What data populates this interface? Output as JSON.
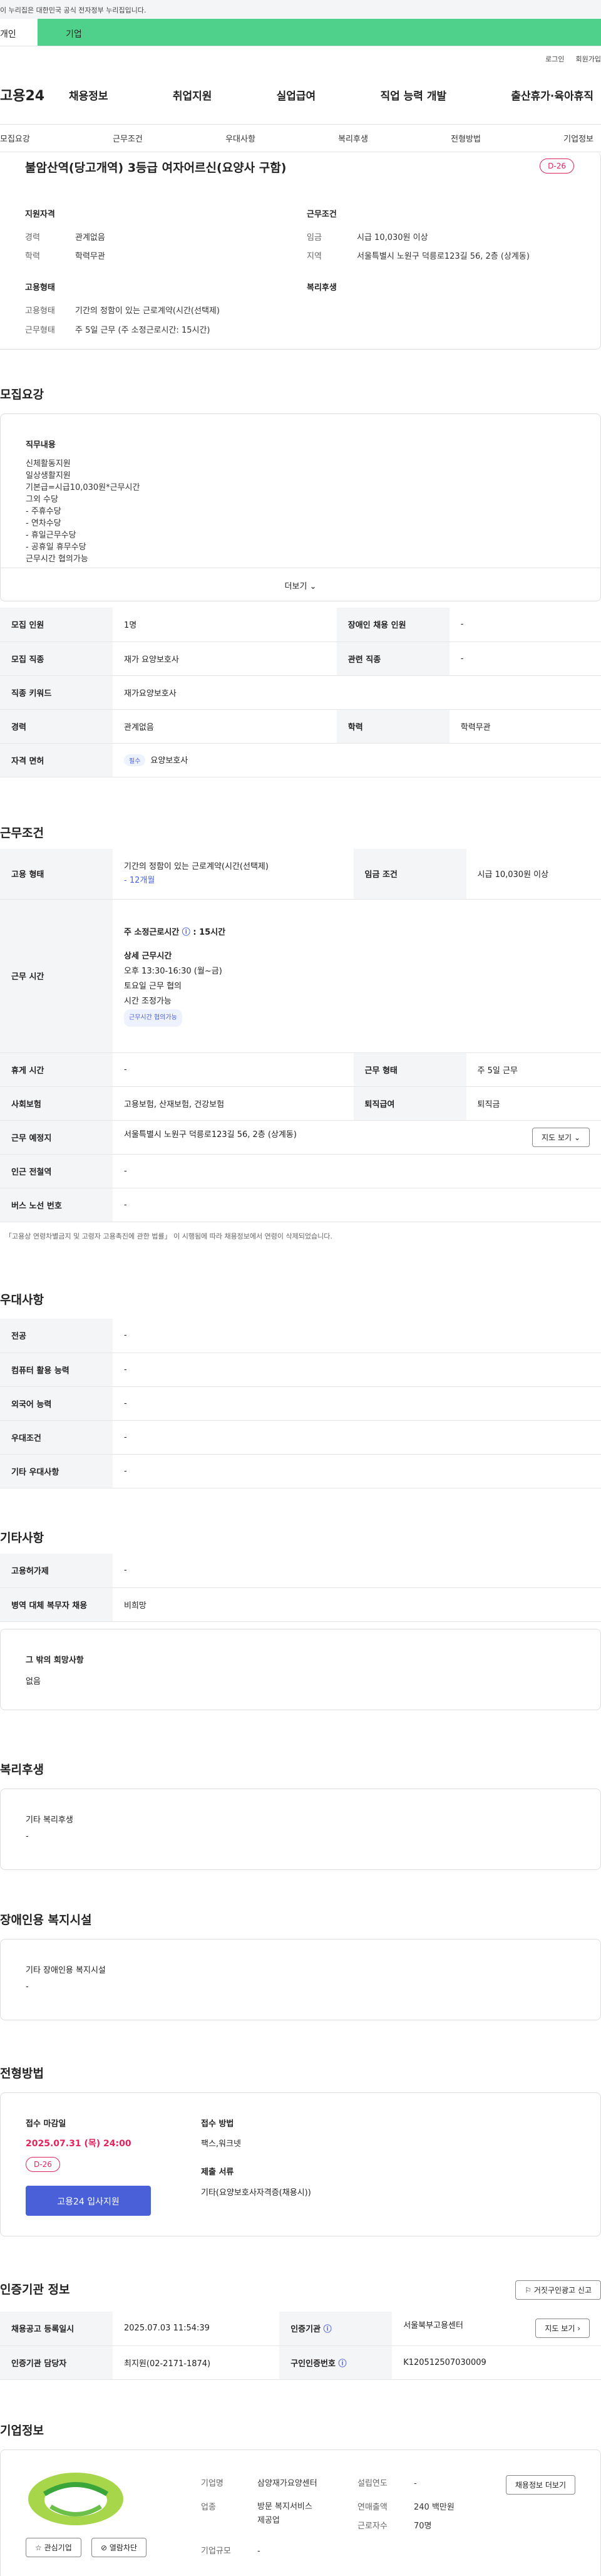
{
  "gov_banner": "이 누리집은 대한민국 공식 전자정부 누리집입니다.",
  "user_tabs": [
    "개인",
    "기업"
  ],
  "util": [
    "로그인",
    "회원가입"
  ],
  "logo": "고용24",
  "gnb": [
    "채용정보",
    "취업지원",
    "실업급여",
    "직업 능력 개발",
    "출산휴가·육아휴직"
  ],
  "subnav": [
    "모집요강",
    "근무조건",
    "우대사항",
    "복리후생",
    "전형방법",
    "기업정보"
  ],
  "summary": {
    "title": "불암산역(당고개역) 3등급 여자어르신(요양사 구함)",
    "dday": "D-26",
    "qual_head": "지원자격",
    "cond_head": "근무조건",
    "career_k": "경력",
    "career_v": "관계없음",
    "edu_k": "학력",
    "edu_v": "학력무관",
    "wage_k": "임금",
    "wage_v": "시급 10,030원 이상",
    "region_k": "지역",
    "region_v": "서울특별시 노원구 덕릉로123길 56, 2층 (상계동)",
    "emp_head": "고용형태",
    "welfare_head": "복리후생",
    "emptype_k": "고용형태",
    "emptype_v": "기간의 정함이 있는 근로계약(시간(선택제)",
    "worktype_k": "근무형태",
    "worktype_v": "주 5일 근무 (주 소정근로시간: 15시간)"
  },
  "recruit": {
    "title": "모집요강",
    "duty_head": "직무내용",
    "duty_lines": [
      "신체활동지원",
      "일상생활지원",
      "기본급=시급10,030원*근무시간",
      "그외 수당",
      "- 주휴수당",
      "- 연차수당",
      "- 휴일근무수당",
      "- 공휴일 휴무수당",
      "근무시간 협의가능"
    ],
    "more": "더보기",
    "rows": [
      {
        "k1": "모집 인원",
        "v1": "1명",
        "k2": "장애인 채용 인원",
        "v2": "-"
      },
      {
        "k1": "모집 직종",
        "v1": "재가 요양보호사",
        "k2": "관련 직종",
        "v2": "-"
      },
      {
        "k1": "직종 키워드",
        "v1": "재가요양보호사"
      },
      {
        "k1": "경력",
        "v1": "관계없음",
        "k2": "학력",
        "v2": "학력무관"
      },
      {
        "k1": "자격 면허",
        "tag": "필수",
        "v1": "요양보호사"
      }
    ]
  },
  "workcond": {
    "title": "근무조건",
    "emptype_k": "고용 형태",
    "emptype_v": "기간의 정함이 있는 근로계약(시간(선택제)",
    "emptype_v2": "- 12개월",
    "wage_k": "임금 조건",
    "wage_v": "시급 10,030원 이상",
    "time_k": "근무 시간",
    "time_head": "주 소정근로시간",
    "time_hours": "15시간",
    "time_detail_head": "상세 근무시간",
    "time_detail": [
      "오후 13:30-16:30 (월~금)",
      "토요일 근무 협의",
      "시간 조정가능"
    ],
    "time_tag": "근무시간 협의가능",
    "rest_k": "휴게 시간",
    "rest_v": "-",
    "form_k": "근무 형태",
    "form_v": "주 5일 근무",
    "ins_k": "사회보험",
    "ins_v": "고용보험, 산재보험, 건강보험",
    "ret_k": "퇴직급여",
    "ret_v": "퇴직금",
    "loc_k": "근무 예정지",
    "loc_v": "서울특별시 노원구 덕릉로123길 56, 2층 (상계동)",
    "map": "지도 보기",
    "subway_k": "인근 전철역",
    "subway_v": "-",
    "bus_k": "버스 노선 번호",
    "bus_v": "-",
    "note": "「고용상 연령차별금지 및 고령자 고용촉진에 관한 법률」 이 시행됨에 따라 채용정보에서 연령이 삭제되었습니다."
  },
  "pref": {
    "title": "우대사항",
    "rows": [
      [
        "전공",
        "-"
      ],
      [
        "컴퓨터 활용 능력",
        "-"
      ],
      [
        "외국어 능력",
        "-"
      ],
      [
        "우대조건",
        "-"
      ],
      [
        "기타 우대사항",
        "-"
      ]
    ]
  },
  "etc": {
    "title": "기타사항",
    "rows": [
      [
        "고용허가제",
        "-"
      ],
      [
        "병역 대체 복무자 채용",
        "비희망"
      ]
    ],
    "other_head": "그 밖의 희망사항",
    "other_v": "없음"
  },
  "welfare": {
    "title": "복리후생",
    "head": "기타 복리후생",
    "v": "-"
  },
  "disab": {
    "title": "장애인용 복지시설",
    "head": "기타 장애인용 복지시설",
    "v": "-"
  },
  "process": {
    "title": "전형방법",
    "deadline_k": "접수 마감일",
    "deadline_v": "2025.07.31 (목) 24:00",
    "dday": "D-26",
    "apply": "고용24 입사지원",
    "method_k": "접수 방법",
    "method_v": "팩스,워크넷",
    "docs_k": "제출 서류",
    "docs_v": "기타(요양보호사자격증(채용시))"
  },
  "agency": {
    "title": "인증기관 정보",
    "report": "거짓구인광고 신고",
    "reg_k": "채용공고 등록일시",
    "reg_v": "2025.07.03 11:54:39",
    "org_k": "인증기관",
    "org_v": "서울북부고용센터",
    "map": "지도 보기",
    "mgr_k": "인증기관 담당자",
    "mgr_v": "최지원(02-2171-1874)",
    "no_k": "구인인증번호",
    "no_v": "K120512507030009"
  },
  "company": {
    "title": "기업정보",
    "name_k": "기업명",
    "name_v": "삼양재가요양센터",
    "industry_k": "업종",
    "industry_v": [
      "방문 복지서비스",
      "제공업"
    ],
    "size_k": "기업규모",
    "size_v": "-",
    "est_k": "설립연도",
    "est_v": "-",
    "sales_k": "연매출액",
    "sales_v": "240 백만원",
    "emp_k": "근로자수",
    "emp_v": "70명",
    "fav": "관심기업",
    "block": "열람차단",
    "jobs": "채용정보 더보기"
  }
}
